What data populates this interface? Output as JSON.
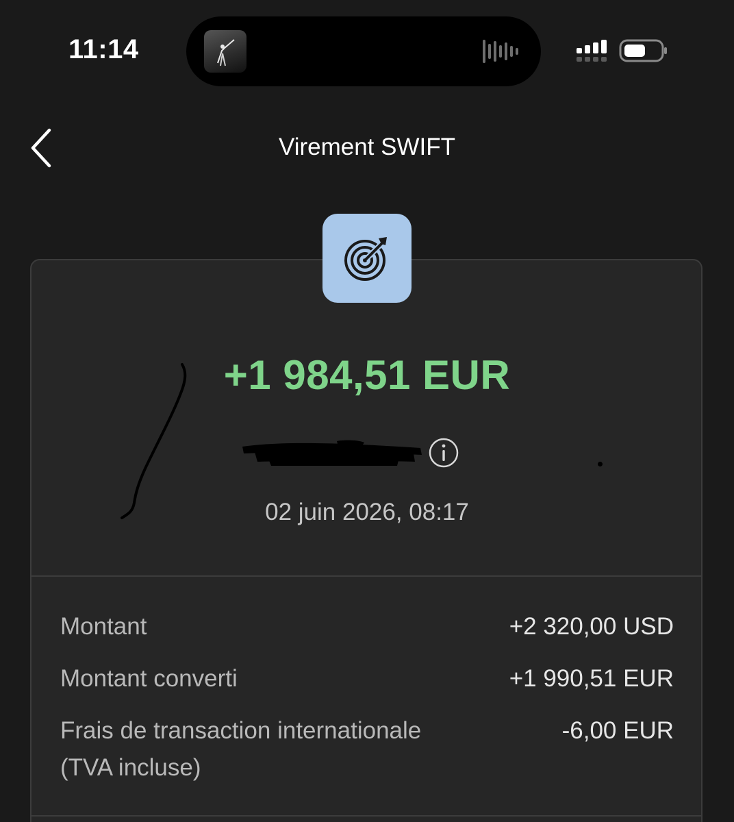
{
  "status_bar": {
    "time": "11:14",
    "icons": [
      "now-playing-artwork-icon",
      "audio-waveform-icon",
      "cellular-signal-icon",
      "battery-icon"
    ]
  },
  "nav": {
    "title": "Virement SWIFT",
    "back_icon": "chevron-left-icon"
  },
  "transaction": {
    "category_icon": "target-icon",
    "category_color": "#a9c8ea",
    "amount": "+1 984,51 EUR",
    "amount_color": "#7fd48a",
    "date": "02 juin 2026, 08:17",
    "info_icon": "info-icon"
  },
  "details": [
    {
      "label": "Montant",
      "value": "+2 320,00 USD"
    },
    {
      "label": "Montant converti",
      "value": "+1 990,51 EUR"
    },
    {
      "label": "Frais de transaction internationale",
      "label_line2": "(TVA incluse)",
      "value": "-6,00 EUR"
    }
  ]
}
